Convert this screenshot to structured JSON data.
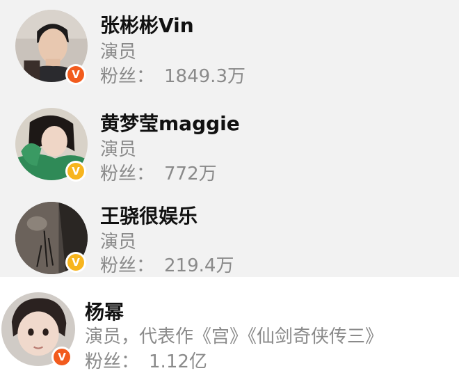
{
  "colors": {
    "top_background": "#f2f2f2",
    "bottom_background": "#ffffff",
    "name_text": "#111111",
    "secondary_text": "#8a8a8a",
    "badge_red": "#f25b1d",
    "badge_gold": "#f7b51e"
  },
  "profiles": [
    {
      "name": "张彬彬Vin",
      "role": "演员",
      "fans_label": "粉丝：",
      "fans_value": "1849.3万",
      "badge_icon": "verified-badge-red-icon",
      "badge_text": "V",
      "avatar_icon": "avatar-photo-icon"
    },
    {
      "name": "黄梦莹maggie",
      "role": "演员",
      "fans_label": "粉丝：",
      "fans_value": "772万",
      "badge_icon": "verified-badge-gold-icon",
      "badge_text": "V",
      "avatar_icon": "avatar-photo-icon"
    },
    {
      "name": "王骁很娱乐",
      "role": "演员",
      "fans_label": "粉丝：",
      "fans_value": "219.4万",
      "badge_icon": "verified-badge-gold-icon",
      "badge_text": "V",
      "avatar_icon": "avatar-photo-icon"
    },
    {
      "name": "杨幂",
      "role": "演员，代表作《宫》《仙剑奇侠传三》",
      "fans_label": "粉丝：",
      "fans_value": "1.12亿",
      "badge_icon": "verified-badge-red-icon",
      "badge_text": "V",
      "avatar_icon": "avatar-photo-icon"
    }
  ]
}
